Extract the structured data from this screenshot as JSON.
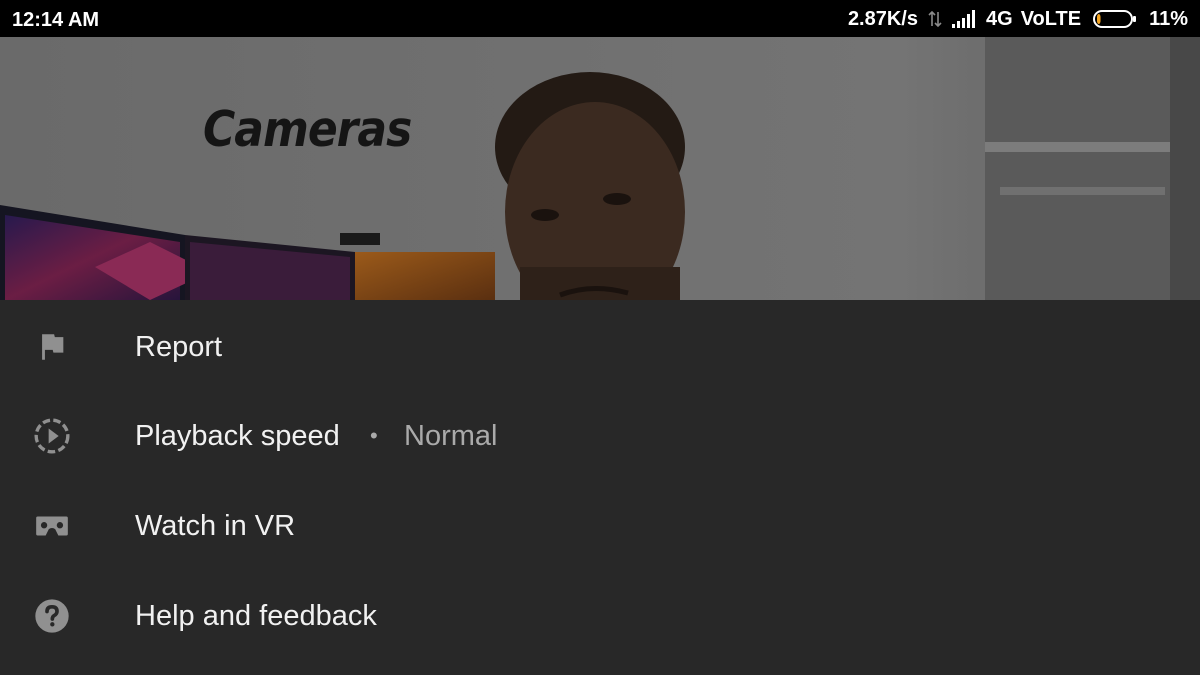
{
  "status_bar": {
    "time": "12:14 AM",
    "network_speed": "2.87K/s",
    "network_type": "4G",
    "volte": "VoLTE",
    "battery_percent": "11%",
    "battery_level": 0.11,
    "icons": [
      "data-arrows-icon",
      "signal-icon",
      "battery-icon"
    ]
  },
  "video": {
    "overlay_text": "Cameras"
  },
  "menu": {
    "items": [
      {
        "label": "Report",
        "icon": "flag-icon"
      },
      {
        "label": "Playback speed",
        "icon": "playback-speed-icon",
        "separator": "•",
        "value": "Normal"
      },
      {
        "label": "Watch in VR",
        "icon": "vr-headset-icon"
      },
      {
        "label": "Help and feedback",
        "icon": "help-icon"
      }
    ]
  },
  "colors": {
    "status_bar_bg": "#000000",
    "sheet_bg": "#282828",
    "label_text": "#f1f1f1",
    "secondary_text": "#aaaaaa",
    "icon": "#909090",
    "battery_fill": "#f5a623"
  }
}
